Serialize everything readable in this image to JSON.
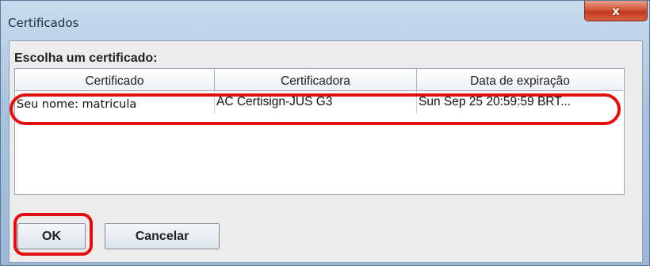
{
  "window": {
    "title": "Certificados",
    "close_glyph": "x"
  },
  "dialog": {
    "prompt": "Escolha um certificado:"
  },
  "table": {
    "columns": [
      "Certificado",
      "Certificadora",
      "Data de expiração"
    ],
    "rows": [
      [
        "Seu nome: matricula",
        "AC Certisign-JUS G3",
        "Sun Sep 25 20:59:59 BRT..."
      ]
    ]
  },
  "buttons": {
    "ok_label": "OK",
    "cancel_label": "Cancelar"
  },
  "annotations": {
    "highlight_color": "#e01010"
  }
}
